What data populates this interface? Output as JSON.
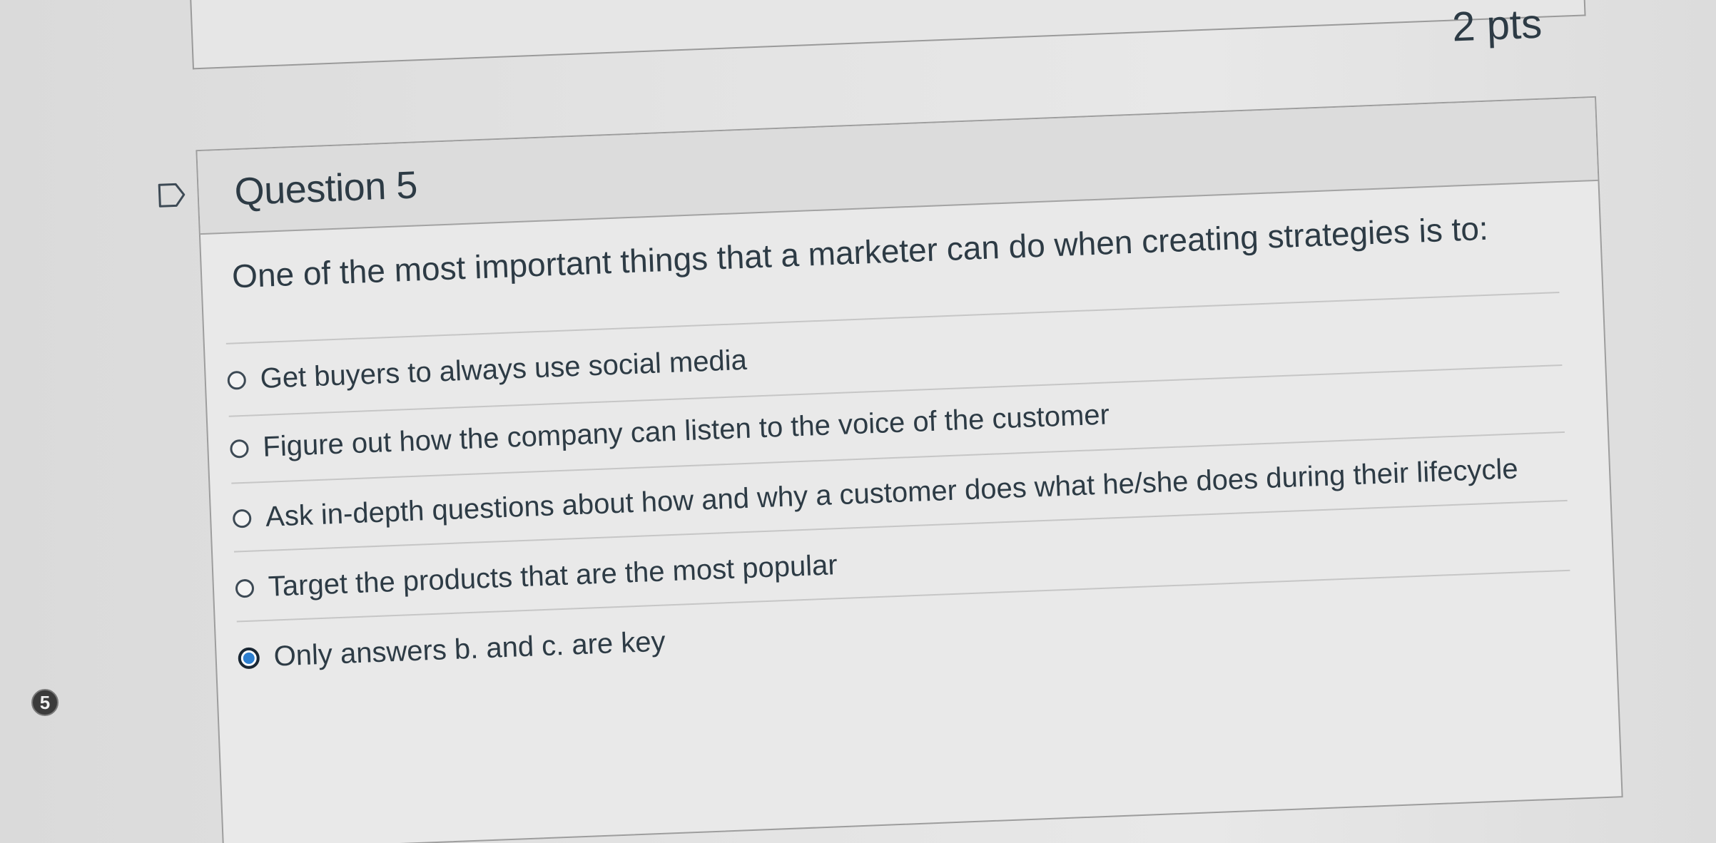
{
  "points": "2 pts",
  "question": {
    "title": "Question 5",
    "text": "One of the most important things that a marketer can do when creating strategies is to:"
  },
  "answers": [
    {
      "label": "Get buyers to always use social media",
      "selected": false
    },
    {
      "label": "Figure out how the company can listen to the voice of the customer",
      "selected": false
    },
    {
      "label": "Ask in-depth questions about how and why a customer does what he/she does during their lifecycle",
      "selected": false
    },
    {
      "label": "Target the products that are the most popular",
      "selected": false
    },
    {
      "label": "Only answers b. and c. are key",
      "selected": true
    }
  ],
  "question_number_badge": "5",
  "colors": {
    "text": "#2d3b45",
    "selected_radio": "#2d7fd0",
    "card_border": "#9d9d9d"
  },
  "icons": {
    "bookmark": "bookmark-flag-icon"
  }
}
